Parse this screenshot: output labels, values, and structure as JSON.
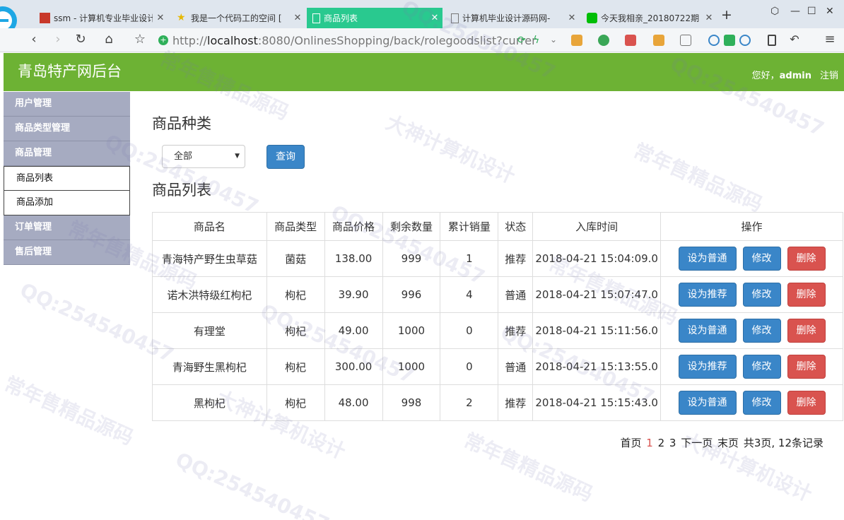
{
  "browser": {
    "tabs": [
      {
        "title": "ssm - 计算机专业毕业设计",
        "icon": "red-favicon"
      },
      {
        "title": "我是一个代码工的空间 [",
        "icon": "star-favicon"
      },
      {
        "title": "商品列表",
        "icon": "page-favicon",
        "active": true
      },
      {
        "title": "计算机毕业设计源码网-",
        "icon": "page-favicon"
      },
      {
        "title": "今天我相亲_20180722期",
        "icon": "iqiyi-favicon"
      }
    ],
    "new_tab": "+",
    "url_prefix": "http://",
    "url_host": "localhost",
    "url_rest": ":8080/OnlinesShopping/back/rolegoodslist?currer"
  },
  "app": {
    "title": "青岛特产网后台",
    "greeting": "您好，",
    "username": "admin",
    "logout": "注销"
  },
  "sidebar": {
    "items": [
      {
        "label": "用户管理"
      },
      {
        "label": "商品类型管理"
      },
      {
        "label": "商品管理"
      }
    ],
    "sub_items": [
      {
        "label": "商品列表"
      },
      {
        "label": "商品添加"
      }
    ],
    "items_after": [
      {
        "label": "订单管理"
      },
      {
        "label": "售后管理"
      }
    ]
  },
  "filter": {
    "title": "商品种类",
    "selected": "全部",
    "query_button": "查询"
  },
  "list": {
    "title": "商品列表",
    "columns": [
      "商品名",
      "商品类型",
      "商品价格",
      "剩余数量",
      "累计销量",
      "状态",
      "入库时间",
      "操作"
    ],
    "rows": [
      {
        "name": "青海特产野生虫草菇",
        "type": "菌菇",
        "price": "138.00",
        "stock": "999",
        "sales": "1",
        "status": "推荐",
        "time": "2018-04-21 15:04:09.0",
        "toggle": "设为普通",
        "edit": "修改",
        "delete": "删除"
      },
      {
        "name": "诺木洪特级红枸杞",
        "type": "枸杞",
        "price": "39.90",
        "stock": "996",
        "sales": "4",
        "status": "普通",
        "time": "2018-04-21 15:07:47.0",
        "toggle": "设为推荐",
        "edit": "修改",
        "delete": "删除"
      },
      {
        "name": "有理堂",
        "type": "枸杞",
        "price": "49.00",
        "stock": "1000",
        "sales": "0",
        "status": "推荐",
        "time": "2018-04-21 15:11:56.0",
        "toggle": "设为普通",
        "edit": "修改",
        "delete": "删除"
      },
      {
        "name": "青海野生黑枸杞",
        "type": "枸杞",
        "price": "300.00",
        "stock": "1000",
        "sales": "0",
        "status": "普通",
        "time": "2018-04-21 15:13:55.0",
        "toggle": "设为推荐",
        "edit": "修改",
        "delete": "删除"
      },
      {
        "name": "黑枸杞",
        "type": "枸杞",
        "price": "48.00",
        "stock": "998",
        "sales": "2",
        "status": "推荐",
        "time": "2018-04-21 15:15:43.0",
        "toggle": "设为普通",
        "edit": "修改",
        "delete": "删除"
      }
    ]
  },
  "pager": {
    "first": "首页",
    "pages": [
      "1",
      "2",
      "3"
    ],
    "next": "下一页",
    "last": "末页",
    "summary": "共3页, 12条记录"
  },
  "watermarks": [
    "常年售精品源码",
    "大神计算机设计",
    "QQ:254540457"
  ],
  "colors": {
    "header": "#6db234",
    "sidebar": "#a6abc1",
    "primary": "#3a86c8",
    "danger": "#d9534f",
    "active_tab": "#29c98f"
  }
}
